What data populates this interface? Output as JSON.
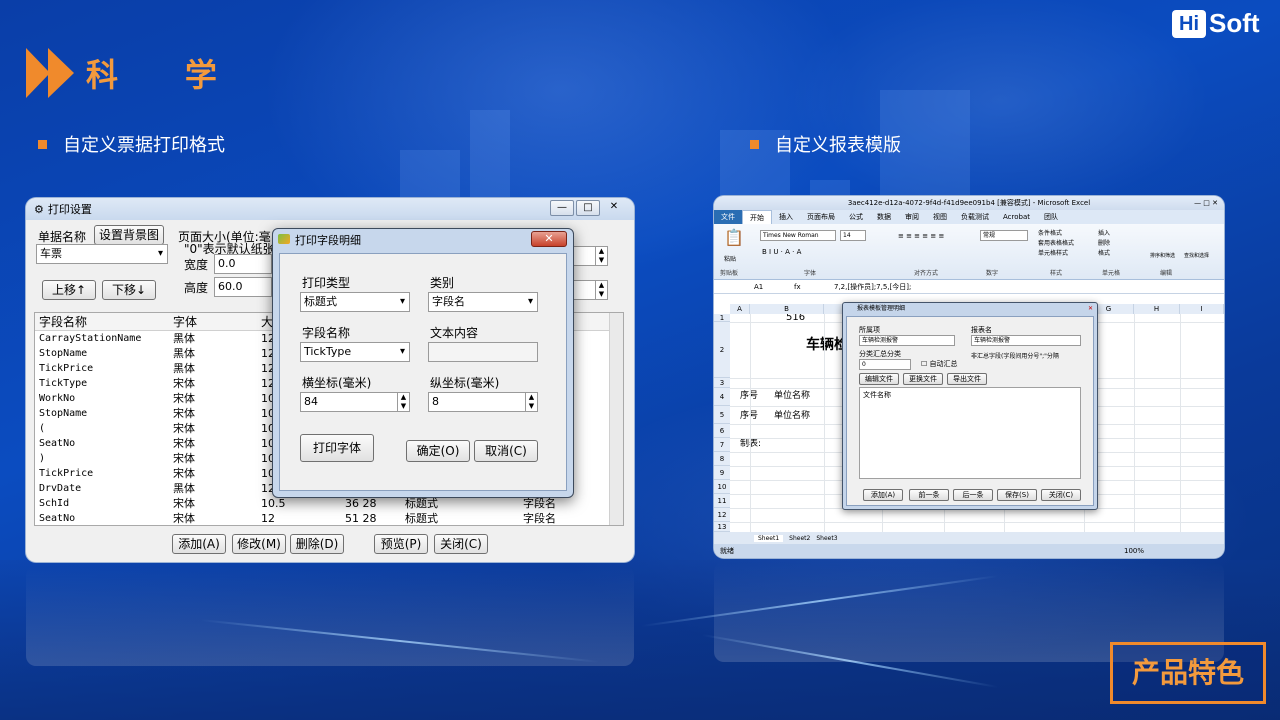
{
  "brand": {
    "hi": "Hi",
    "soft": "Soft"
  },
  "section_title": "科      学",
  "bullets": {
    "left": "自定义票据打印格式",
    "right": "自定义报表模版"
  },
  "feature_badge": "产品特色",
  "colors": {
    "accent": "#f08a2c",
    "background": "#0b4cc0"
  },
  "print_settings": {
    "title": "打印设置",
    "title_btns": [
      "—",
      "□",
      "✕"
    ],
    "bill_name_label": "单据名称",
    "set_background_btn": "设置背景图",
    "bill_name_value": "车票",
    "page_size_text": "页面大小(单位:毫",
    "page_size_note": "\"0\"表示默认纸张",
    "width_label": "宽度",
    "width_value": "0.0",
    "height_label": "高度",
    "height_value": "60.0",
    "move_up_btn": "上移↑",
    "move_down_btn": "下移↓",
    "columns": [
      "字段名称",
      "字体",
      "大"
    ],
    "rows": [
      [
        "CarrayStationName",
        "黑体",
        "12",
        "",
        "",
        ""
      ],
      [
        "StopName",
        "黑体",
        "12",
        "",
        "",
        ""
      ],
      [
        "TickPrice",
        "黑体",
        "12",
        "",
        "",
        ""
      ],
      [
        "TickType",
        "宋体",
        "12",
        "",
        "",
        ""
      ],
      [
        "WorkNo",
        "宋体",
        "10",
        "",
        "",
        ""
      ],
      [
        "StopName",
        "宋体",
        "10",
        "",
        "",
        ""
      ],
      [
        "(",
        "宋体",
        "10",
        "",
        "",
        ""
      ],
      [
        "SeatNo",
        "宋体",
        "10",
        "",
        "",
        ""
      ],
      [
        ")",
        "宋体",
        "10",
        "",
        "",
        ""
      ],
      [
        "TickPrice",
        "宋体",
        "10",
        "",
        "",
        ""
      ],
      [
        "DrvDate",
        "黑体",
        "12",
        "",
        "",
        ""
      ],
      [
        "SchId",
        "宋体",
        "10.5",
        "36  28",
        "标题式",
        "字段名"
      ],
      [
        "SeatNo",
        "宋体",
        "12",
        "51  28",
        "标题式",
        "字段名"
      ]
    ],
    "buttons": [
      "添加(A)",
      "修改(M)",
      "删除(D)",
      "预览(P)",
      "关闭(C)"
    ]
  },
  "field_dialog": {
    "title": "打印字段明细",
    "close": "✕",
    "print_type_label": "打印类型",
    "print_type_value": "标题式",
    "category_label": "类别",
    "category_value": "字段名",
    "field_name_label": "字段名称",
    "field_name_value": "TickType",
    "text_content_label": "文本内容",
    "text_content_value": "",
    "x_label": "横坐标(毫米)",
    "x_value": "84",
    "y_label": "纵坐标(毫米)",
    "y_value": "8",
    "font_btn": "打印字体",
    "ok_btn": "确定(O)",
    "cancel_btn": "取消(C)"
  },
  "excel": {
    "title": "3aec412e-d12a-4072-9f4d-f41d9ee091b4 [兼容模式] - Microsoft Excel",
    "menu": [
      "文件",
      "开始",
      "插入",
      "页面布局",
      "公式",
      "数据",
      "审阅",
      "视图",
      "负载测试",
      "Acrobat",
      "团队"
    ],
    "font_name": "Times New Roman",
    "font_size": "14",
    "number_format": "常规",
    "ribbon_groups": [
      "剪贴板",
      "字体",
      "对齐方式",
      "数字",
      "样式",
      "单元格",
      "编辑"
    ],
    "ribbon_paste": "粘贴",
    "ribbon_cond_format": "条件格式",
    "ribbon_table_format": "套用表格格式",
    "ribbon_cell_style": "单元格样式",
    "ribbon_insert": "插入",
    "ribbon_delete": "删除",
    "ribbon_format": "格式",
    "ribbon_sort": "排序和筛选",
    "ribbon_find": "查找和选择",
    "name_box": "A1",
    "formula": "7,2,[操作员];7,5,[今日];",
    "col_headers": [
      "A",
      "B",
      "C",
      "D",
      "E",
      "F",
      "G",
      "H",
      "I"
    ],
    "row_headers": [
      "1",
      "2",
      "3",
      "4",
      "5",
      "6",
      "7",
      "8",
      "9",
      "10",
      "11",
      "12",
      "13"
    ],
    "cell_516": "516",
    "cell_title": "车辆检",
    "cell_seq": "序号",
    "cell_unit": "单位名称",
    "cell_seq2": "序号",
    "cell_unit2": "单位名称",
    "cell_maker": "制表:",
    "sheet_tabs": [
      "Sheet1",
      "Sheet2",
      "Sheet3"
    ],
    "status": "就绪",
    "zoom": "100%"
  },
  "template_dialog": {
    "title": "报表模板管理明细",
    "category_label": "所属项",
    "category_value": "车辆检测报警",
    "report_name_label": "报表名",
    "report_name_value": "车辆检测报警",
    "group_label": "分类汇总分类",
    "group_value": "0",
    "auto_sum": "自动汇总",
    "note": "非汇总字段(字段间用分号\";\"分隔",
    "edit_file_btn": "编辑文件",
    "replace_file_btn": "更换文件",
    "export_file_btn": "导出文件",
    "file_name_label": "文件名称",
    "buttons": [
      "添加(A)",
      "前一条",
      "后一条",
      "保存(S)",
      "关闭(C)"
    ]
  }
}
